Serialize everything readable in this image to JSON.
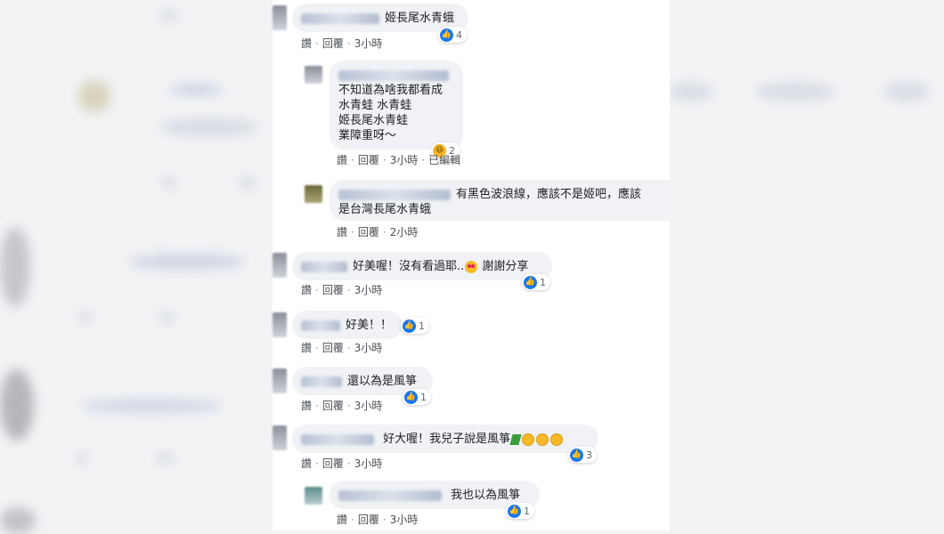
{
  "actions": {
    "like": "讚",
    "reply": "回覆",
    "sep": "·",
    "edited": "已編輯"
  },
  "comments": [
    {
      "text": "姬長尾水青蛾",
      "time": "3小時",
      "reaction_count": "4"
    },
    {
      "lines": [
        "不知道為啥我都看成",
        "水青蛙 水青蛙",
        "姬長尾水青蛙",
        "業障重呀～"
      ],
      "time": "3小時",
      "reaction_count": "2"
    },
    {
      "text1": "有黑色波浪線，應該不是姬吧，應該",
      "text2": "是台灣長尾水青蛾",
      "time": "2小時"
    },
    {
      "text": "好美喔！沒有看過耶..",
      "text_after": "謝謝分享",
      "time": "3小時",
      "reaction_count": "1"
    },
    {
      "text": "好美！！",
      "time": "3小時",
      "reaction_count": "1"
    },
    {
      "text": "還以為是風箏",
      "time": "3小時",
      "reaction_count": "1"
    },
    {
      "text": "好大喔！我兒子說是風箏",
      "time": "3小時",
      "reaction_count": "3"
    },
    {
      "text": "我也以為風箏",
      "time": "3小時",
      "reaction_count": "1"
    }
  ],
  "colors": {
    "like": "#1877f2",
    "bubble": "#f0f2f5"
  }
}
